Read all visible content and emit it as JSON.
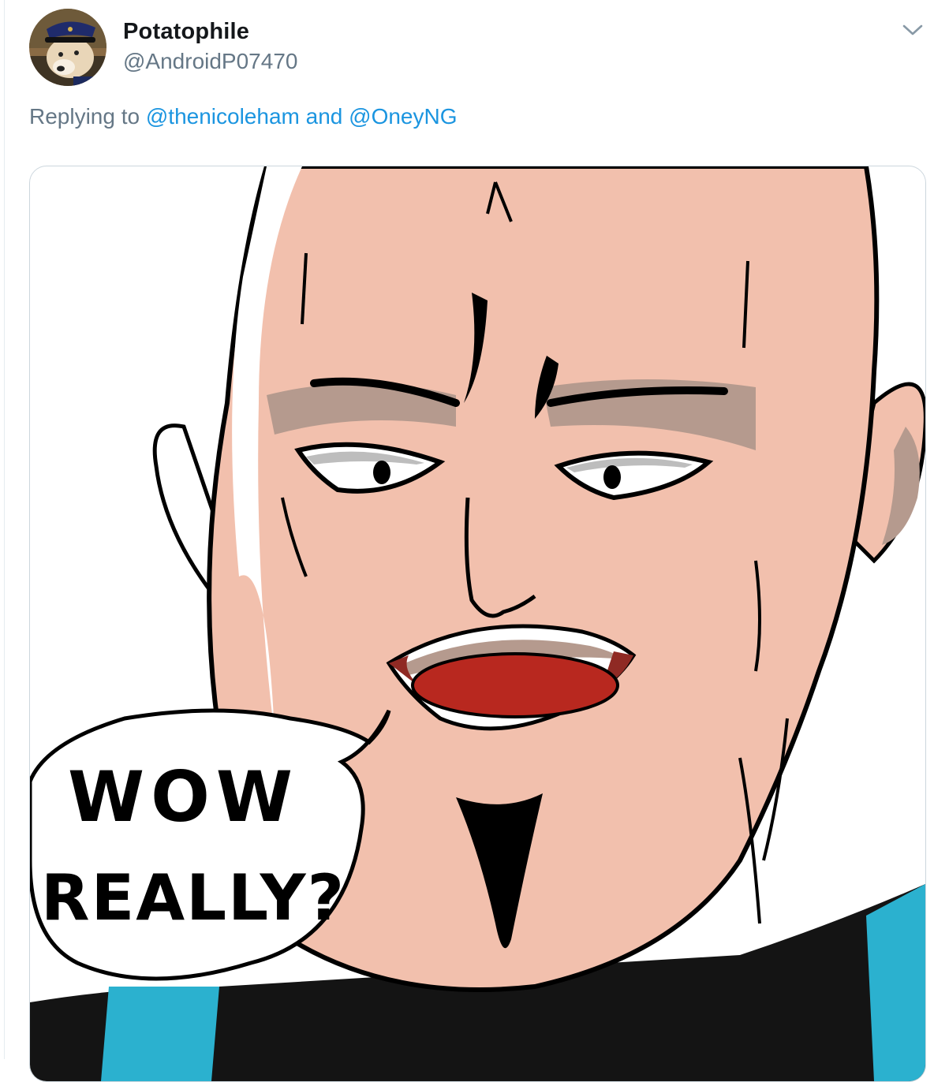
{
  "tweet": {
    "author": {
      "display_name": "Potatophile",
      "handle": "@AndroidP07470",
      "avatar_icon": "dog-with-captain-hat-avatar"
    },
    "menu_icon": "chevron-down-icon",
    "reply_context": {
      "prefix": "Replying to",
      "mentions": [
        "@thenicoleham",
        "@OneyNG"
      ],
      "joiner": "and"
    },
    "media": {
      "speech_bubble": {
        "line1": "WOW",
        "line2": "REALLY?"
      }
    }
  },
  "colors": {
    "name": "#14171a",
    "secondary": "#657786",
    "link": "#1b95e0",
    "skin": "#f2c0ad",
    "lips": "#b8281f",
    "shirt_trim": "#2bb1cf"
  }
}
